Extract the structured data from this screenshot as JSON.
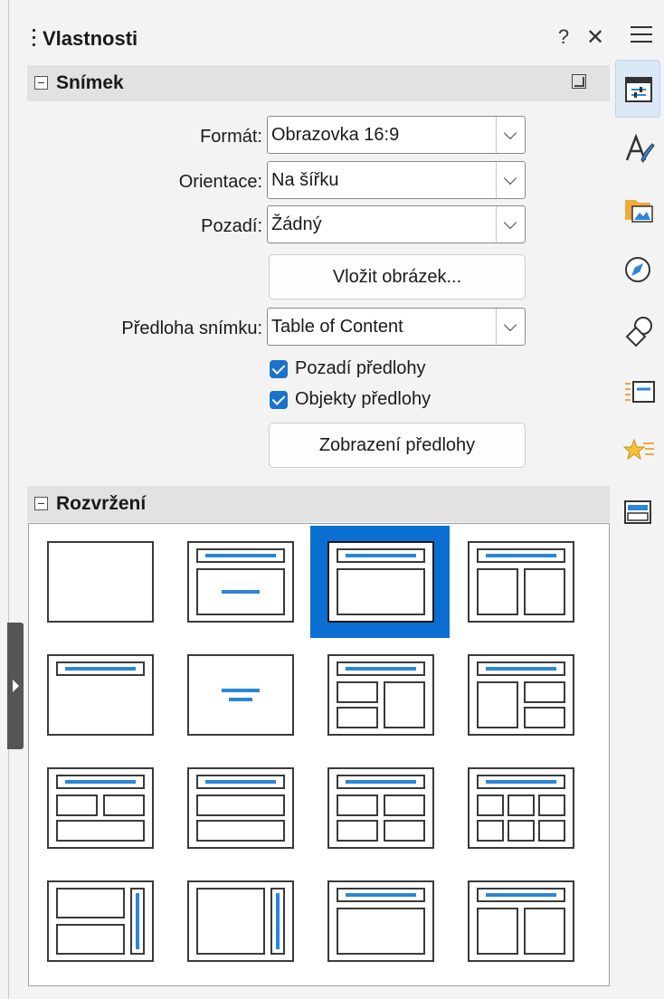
{
  "panel": {
    "title": "Vlastnosti",
    "help_glyph": "?",
    "close_glyph": "✕"
  },
  "slide_section": {
    "title": "Snímek",
    "fields": {
      "format_label": "Formát:",
      "format_value": "Obrazovka 16:9",
      "orientation_label": "Orientace:",
      "orientation_value": "Na šířku",
      "background_label": "Pozadí:",
      "background_value": "Žádný",
      "insert_image_button": "Vložit obrázek...",
      "master_label": "Předloha snímku:",
      "master_value": "Table of Content",
      "master_background_check": "Pozadí předlohy",
      "master_background_checked": true,
      "master_objects_check": "Objekty předlohy",
      "master_objects_checked": true,
      "master_view_button": "Zobrazení předlohy"
    }
  },
  "layouts_section": {
    "title": "Rozvržení",
    "selected_index": 2,
    "items": [
      "blank",
      "title-content-line",
      "title-content",
      "title-two-content",
      "title-only",
      "centered-text",
      "title-content-two",
      "title-two-content-split",
      "title-two-over-content",
      "title-content-over-two",
      "title-four-content",
      "title-six-content",
      "vertical-title-two",
      "vertical-title-content",
      "title-content-wide",
      "title-two-content-wide"
    ]
  },
  "tab_bar": {
    "active": "properties",
    "tabs": [
      "properties-icon",
      "styles-icon",
      "gallery-icon",
      "navigator-icon",
      "shapes-icon",
      "slide-transition-icon",
      "animation-icon",
      "master-slides-icon"
    ]
  },
  "colors": {
    "accent": "#0b6fd2",
    "layout_line": "#2a86d8",
    "checkbox": "#1a73c9"
  }
}
